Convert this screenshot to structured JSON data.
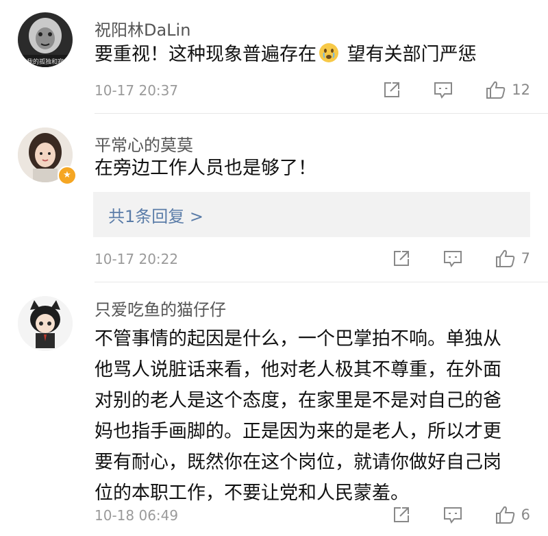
{
  "comments": [
    {
      "username": "祝阳林DaLin",
      "content_before_emoji": "要重视！这种现象普遍存在",
      "content_emoji": "crying-face-emoji",
      "content_after_emoji": " 望有关部门严惩",
      "avatar_caption": "我的孤独和寂",
      "time": "10-17 20:37",
      "like_count": "12"
    },
    {
      "username": "平常心的莫莫",
      "content": "在旁边工作人员也是够了！",
      "reply_link": "共1条回复 >",
      "badge_icon": "star-icon",
      "time": "10-17 20:22",
      "like_count": "7"
    },
    {
      "username": "只爱吃鱼的猫仔仔",
      "content_lines": [
        "不管事情的起因是什么，一个巴掌拍不响。单独从",
        "他骂人说脏话来看，他对老人极其不尊重，在外面",
        "对别的老人是这个态度，在家里是不是对自己的爸",
        "妈也指手画脚的。正是因为来的是老人，所以才更",
        "要有耐心，既然你在这个岗位，就请你做好自己岗",
        "位的本职工作，不要让党和人民蒙羞。"
      ],
      "time": "10-18 06:49",
      "like_count": "6"
    }
  ],
  "icons": {
    "share": "share-icon",
    "comment": "comment-icon",
    "like": "thumbs-up-icon"
  },
  "colors": {
    "reply_link": "#5a7ca8",
    "meta_text": "#9a9a9a",
    "badge": "#f5a623"
  }
}
